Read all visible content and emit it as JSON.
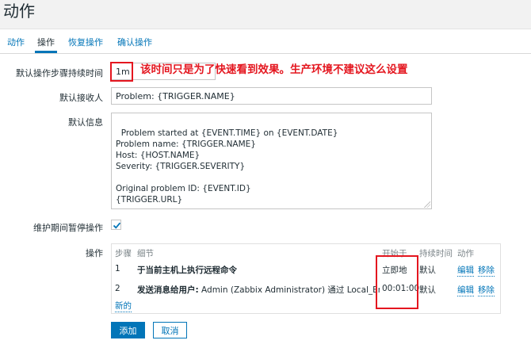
{
  "page": {
    "title": "动作"
  },
  "tabs": [
    {
      "label": "动作",
      "active": false
    },
    {
      "label": "操作",
      "active": true
    },
    {
      "label": "恢复操作",
      "active": false
    },
    {
      "label": "确认操作",
      "active": false
    }
  ],
  "form": {
    "step_duration": {
      "label": "默认操作步骤持续时间",
      "value": "1m"
    },
    "annotation": "该时间只是为了快速看到效果。生产环境不建议这么设置",
    "subject": {
      "label": "默认接收人",
      "value": "Problem: {TRIGGER.NAME}"
    },
    "message": {
      "label": "默认信息",
      "value": "Problem started at {EVENT.TIME} on {EVENT.DATE}\nProblem name: {TRIGGER.NAME}\nHost: {HOST.NAME}\nSeverity: {TRIGGER.SEVERITY}\n\nOriginal problem ID: {EVENT.ID}\n{TRIGGER.URL}"
    },
    "pause": {
      "label": "维护期间暂停操作",
      "checked": true
    }
  },
  "operations": {
    "label": "操作",
    "headers": {
      "steps": "步骤",
      "details": "细节",
      "start_in": "开始于",
      "duration": "持续时间",
      "action": "动作"
    },
    "rows": [
      {
        "step": "1",
        "details_bold": "于当前主机上执行远程命令",
        "details_rest": "",
        "start_in": "立即地",
        "duration": "默认",
        "edit": "编辑",
        "remove": "移除"
      },
      {
        "step": "2",
        "details_bold": "发送消息给用户:",
        "details_rest": " Admin (Zabbix Administrator) 通过 Local_Email",
        "start_in": "00:01:00",
        "duration": "默认",
        "edit": "编辑",
        "remove": "移除"
      }
    ],
    "new_link": "新的"
  },
  "buttons": {
    "add": "添加",
    "cancel": "取消"
  },
  "colors": {
    "accent": "#0275b8",
    "highlight": "#e4161f"
  }
}
